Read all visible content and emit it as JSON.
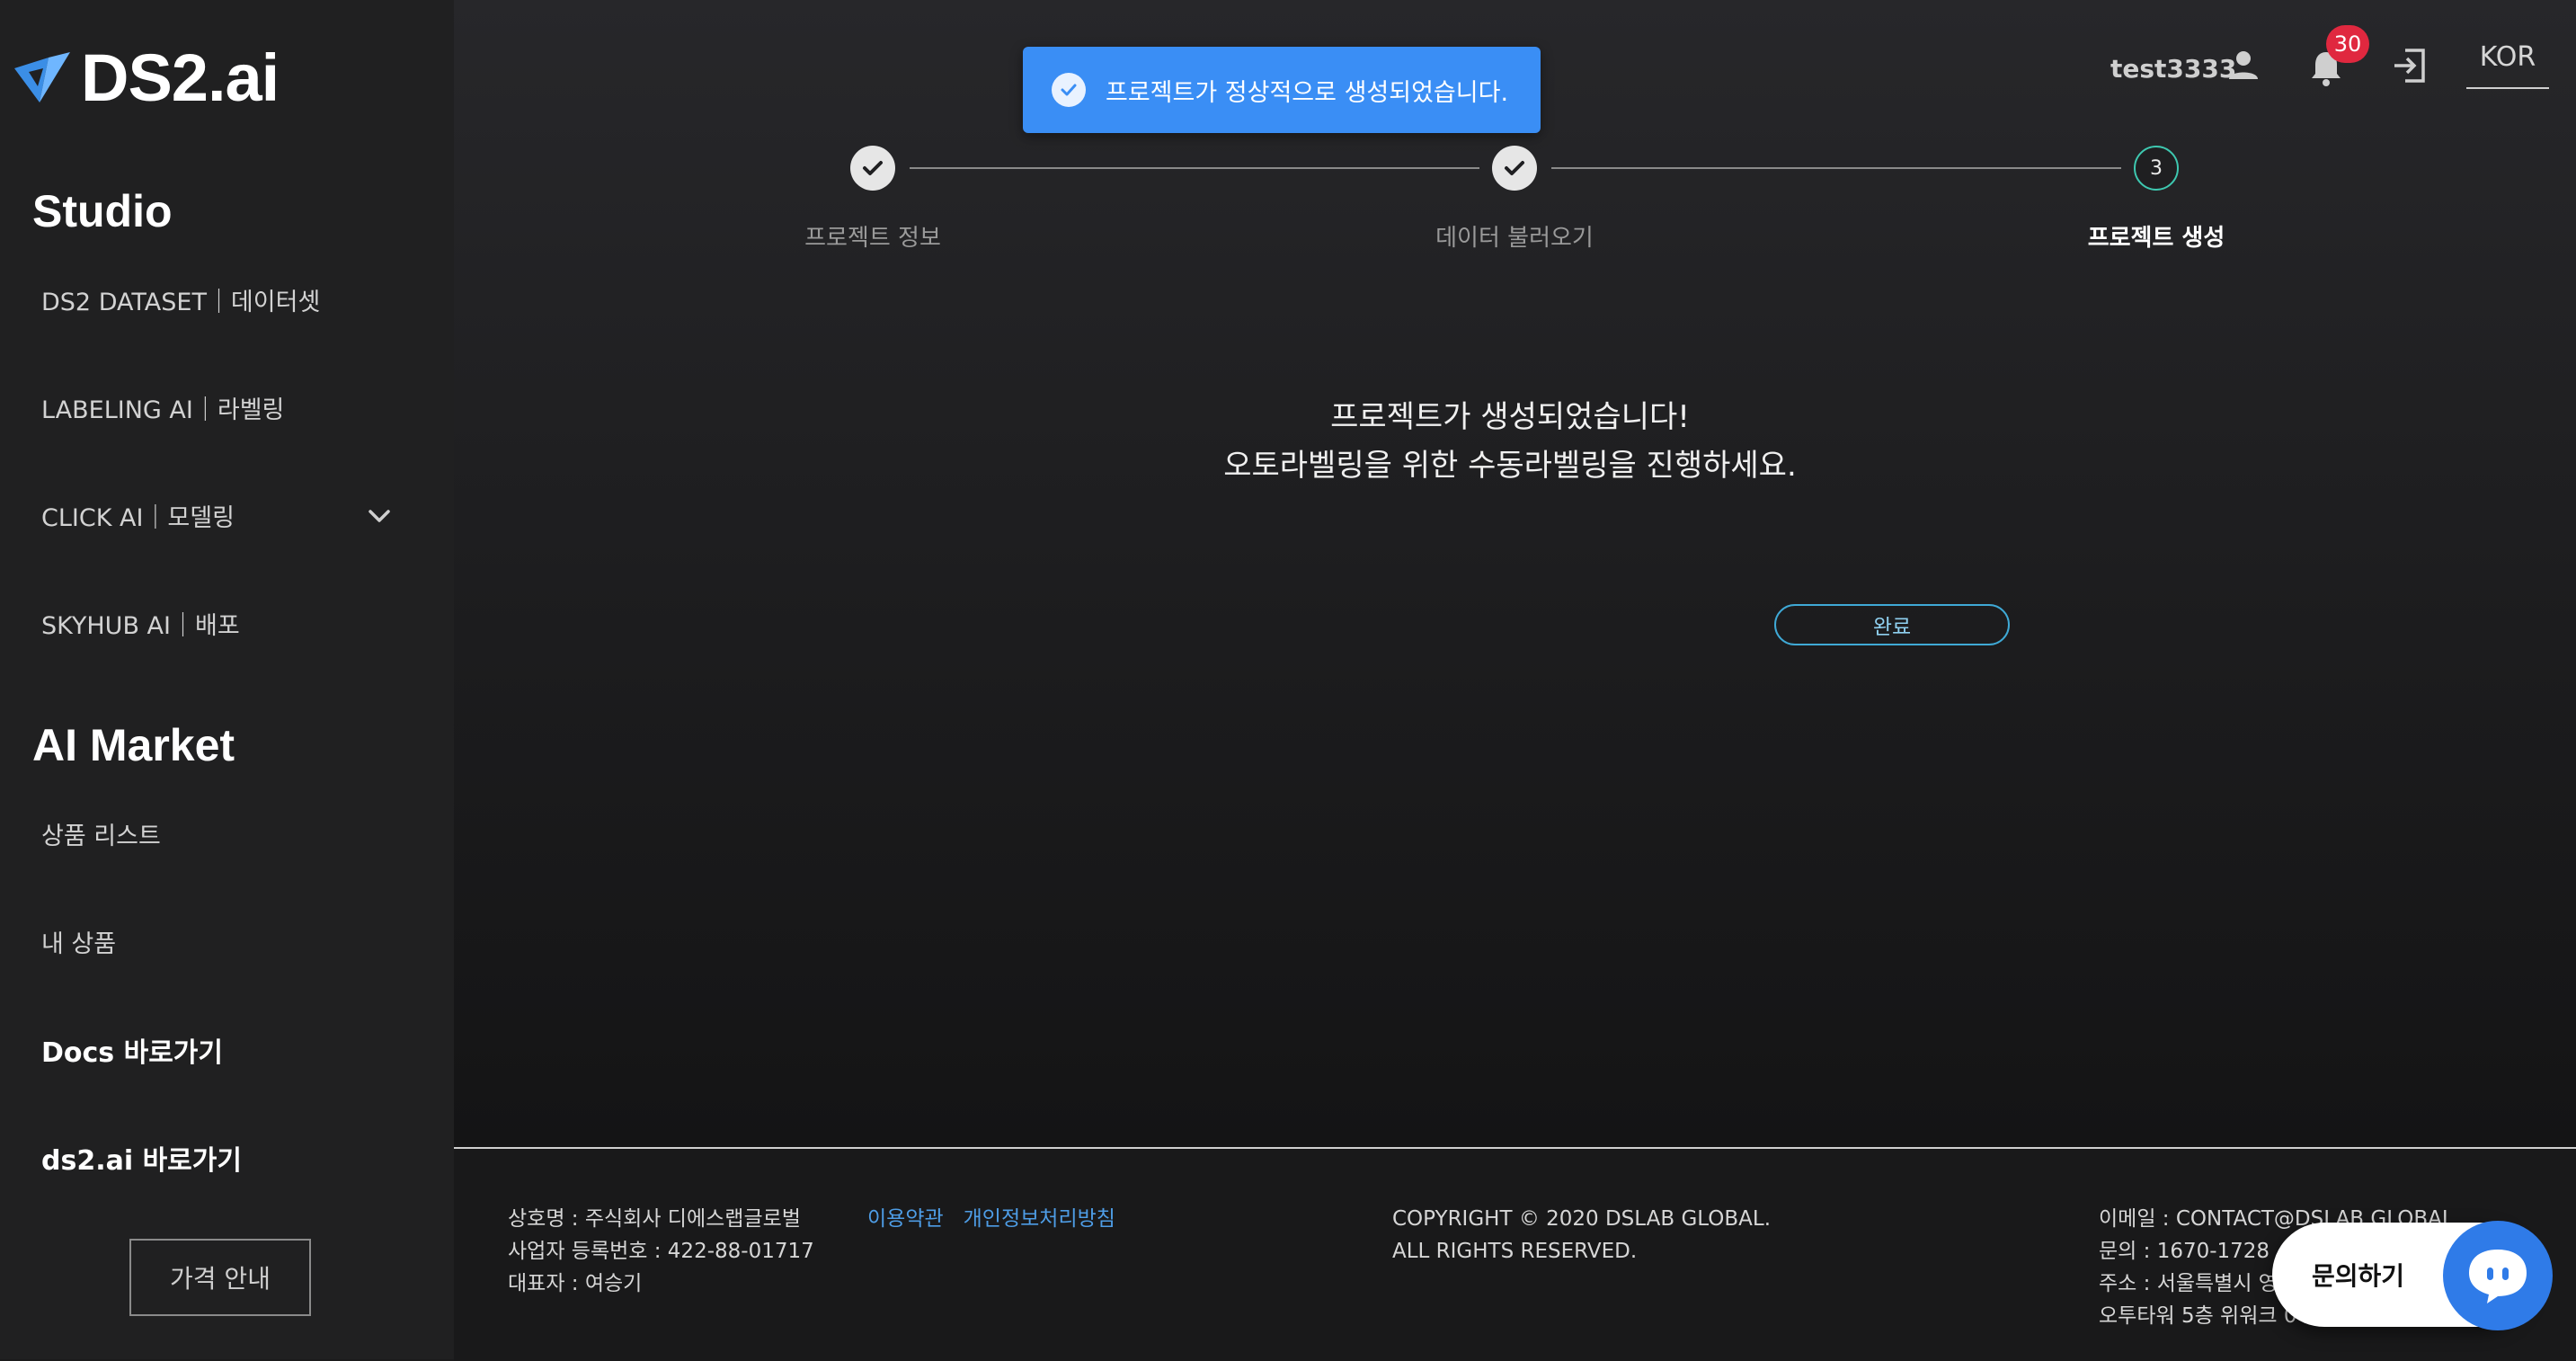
{
  "brand": {
    "logo_text": "DS2.ai"
  },
  "sidebar": {
    "studio_title": "Studio",
    "studio_items": [
      {
        "label": "DS2 DATASET｜데이터셋"
      },
      {
        "label": "LABELING AI｜라벨링"
      },
      {
        "label": "CLICK AI｜모델링"
      },
      {
        "label": "SKYHUB AI｜배포"
      }
    ],
    "market_title": "AI Market",
    "market_items": [
      {
        "label": "상품 리스트"
      },
      {
        "label": "내 상품"
      }
    ],
    "links": [
      {
        "label": "Docs 바로가기"
      },
      {
        "label": "ds2.ai 바로가기"
      }
    ],
    "price_button": "가격 안내"
  },
  "toast": {
    "text": "프로젝트가 정상적으로 생성되었습니다."
  },
  "header": {
    "username": "test3333",
    "notification_count": "30",
    "language": "KOR"
  },
  "stepper": {
    "steps": [
      {
        "label": "프로젝트 정보",
        "status": "done"
      },
      {
        "label": "데이터 불러오기",
        "status": "done"
      },
      {
        "label": "프로젝트 생성",
        "status": "current",
        "number": "3"
      }
    ]
  },
  "message": {
    "line1": "프로젝트가 생성되었습니다!",
    "line2": "오토라벨링을 위한 수동라벨링을 진행하세요."
  },
  "complete_button": "완료",
  "footer": {
    "company": [
      "상호명 : 주식회사 디에스랩글로벌",
      "사업자 등록번호 : 422-88-01717",
      "대표자 : 여승기"
    ],
    "links": [
      "이용약관",
      "개인정보처리방침"
    ],
    "copyright": [
      "COPYRIGHT © 2020 DSLAB GLOBAL.",
      "ALL RIGHTS RESERVED."
    ],
    "contact": [
      "이메일 : CONTACT@DSLAB.GLOBAL",
      "문의 : 1670-1728",
      "주소 : 서울특별시 영",
      "오투타워 5층 위워크 0"
    ]
  },
  "chat": {
    "label": "문의하기"
  },
  "colors": {
    "toast": "#3a8ef5",
    "accent_step": "#3ec8b0",
    "button_border": "#3fa9d6",
    "badge": "#e0283f",
    "chat": "#2f7be8"
  }
}
